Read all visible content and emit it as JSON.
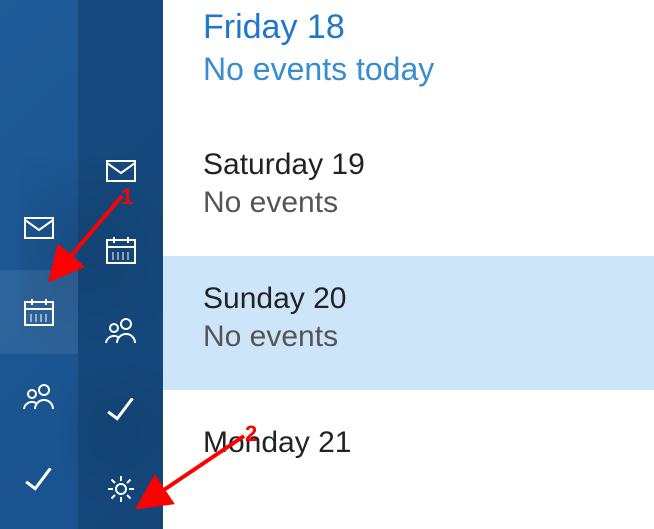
{
  "nav": {
    "mail": "Mail",
    "calendar": "Calendar",
    "people": "People",
    "todo": "To Do",
    "settings": "Settings"
  },
  "days": [
    {
      "title": "Friday 18",
      "sub": "No events today",
      "today": true,
      "highlight": false
    },
    {
      "title": "Saturday 19",
      "sub": "No events",
      "today": false,
      "highlight": false
    },
    {
      "title": "Sunday 20",
      "sub": "No events",
      "today": false,
      "highlight": true
    },
    {
      "title": "Monday 21",
      "sub": "",
      "today": false,
      "highlight": false
    }
  ],
  "annotations": {
    "a1": "1",
    "a2": "2"
  }
}
